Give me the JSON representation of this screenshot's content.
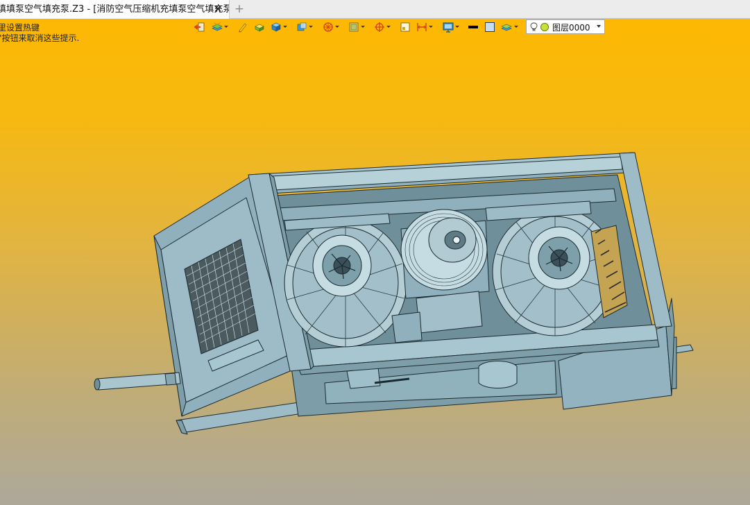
{
  "tab": {
    "title": "填填泵空气填充泵.Z3 - [消防空气压缩机充填泵空气填充泵]",
    "close_glyph": "✕",
    "new_glyph": "+"
  },
  "hints": {
    "line1": "里设置热键",
    "line2": "\"按钮来取消这些提示."
  },
  "toolbar": {
    "icons": [
      "exit-icon",
      "layer-manage-icon",
      "pencil-icon",
      "shaded-box-icon",
      "solid-cube-icon",
      "view-cube-icon",
      "render-sphere-icon",
      "material-icon",
      "snap-target-icon",
      "frame-icon",
      "dimension-icon",
      "display-monitor-icon",
      "line-color-icon",
      "fill-color-icon",
      "layer-stack-icon"
    ],
    "layer_name": "图层0000"
  },
  "colors": {
    "model_fill": "#92b3bf",
    "model_stroke": "#1b2a30",
    "background_top": "#ffb800",
    "background_bottom": "#ada89a"
  }
}
